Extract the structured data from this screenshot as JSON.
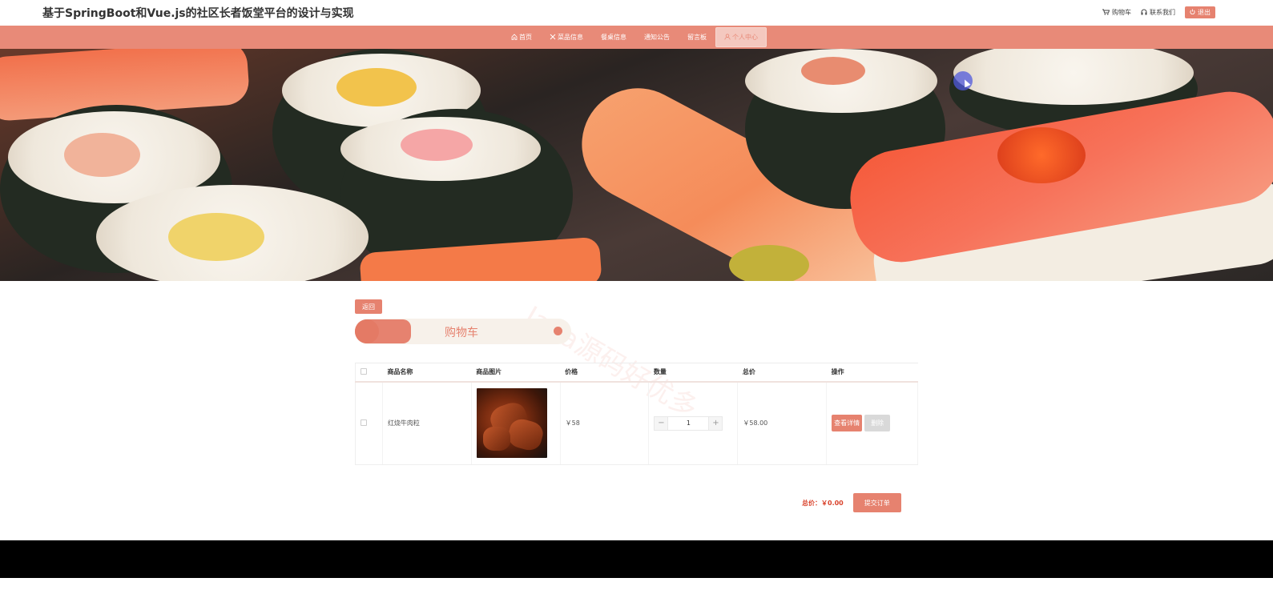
{
  "header": {
    "site_title": "基于SpringBoot和Vue.js的社区长者饭堂平台的设计与实现",
    "cart_link": "购物车",
    "contact_link": "联系我们",
    "logout": "退出"
  },
  "nav": {
    "items": [
      {
        "label": "首页",
        "icon": "home-icon"
      },
      {
        "label": "菜品信息",
        "icon": "utensils-icon"
      },
      {
        "label": "餐桌信息",
        "icon": ""
      },
      {
        "label": "通知公告",
        "icon": ""
      },
      {
        "label": "留言板",
        "icon": ""
      },
      {
        "label": "个人中心",
        "icon": "user-icon",
        "active": true
      }
    ]
  },
  "page": {
    "back_label": "返回",
    "title": "购物车",
    "watermark": "Java源码好优多"
  },
  "cart": {
    "columns": [
      "商品名称",
      "商品图片",
      "价格",
      "数量",
      "总价",
      "操作"
    ],
    "rows": [
      {
        "name": "红烧牛肉粒",
        "price": "￥58",
        "quantity": "1",
        "total": "￥58.00",
        "detail_label": "查看详情",
        "delete_label": "删除"
      }
    ],
    "total_text": "总价：￥0.00",
    "submit_label": "提交订单"
  },
  "colors": {
    "accent": "#e88a78",
    "button": "#e6826f",
    "total_text": "#d9442d",
    "footer": "#000000"
  }
}
